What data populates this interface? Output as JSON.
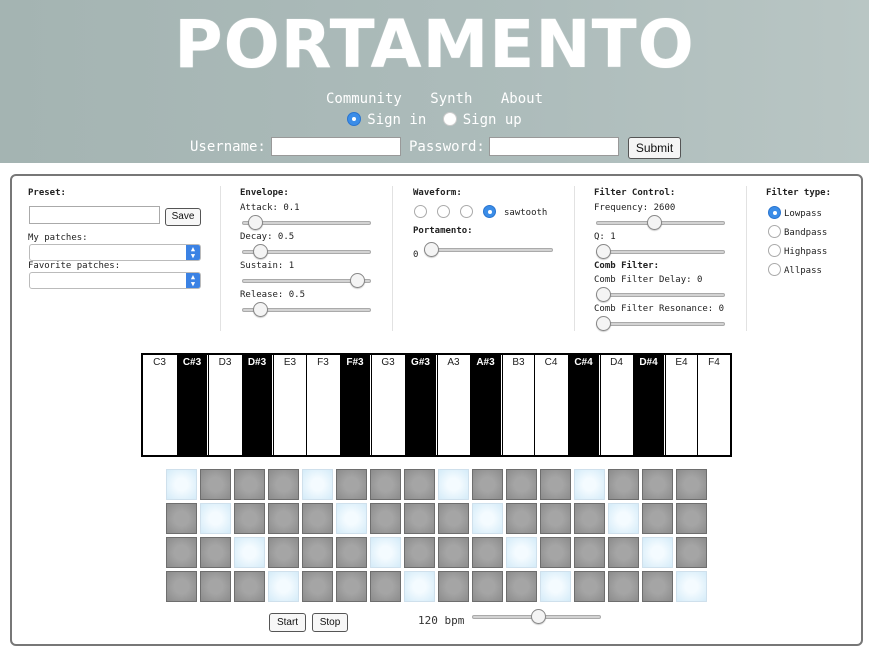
{
  "header": {
    "logo": "PORTAMENTO",
    "nav": [
      "Community",
      "Synth",
      "About"
    ],
    "auth_modes": [
      {
        "label": "Sign in",
        "checked": true
      },
      {
        "label": "Sign up",
        "checked": false
      }
    ],
    "username_label": "Username:",
    "password_label": "Password:",
    "submit_label": "Submit"
  },
  "preset": {
    "title": "Preset:",
    "save_label": "Save",
    "my_patches_label": "My patches:",
    "favorite_patches_label": "Favorite patches:"
  },
  "envelope": {
    "title": "Envelope:",
    "attack": {
      "label": "Attack: 0.1",
      "fraction": 0.05
    },
    "decay": {
      "label": "Decay: 0.5",
      "fraction": 0.1
    },
    "sustain": {
      "label": "Sustain: 1",
      "fraction": 0.95
    },
    "release": {
      "label": "Release: 0.5",
      "fraction": 0.1
    }
  },
  "waveform": {
    "title": "Waveform:",
    "selected_label": "sawtooth",
    "options_checked": [
      false,
      false,
      false,
      true
    ],
    "portamento_title": "Portamento:",
    "portamento_value": "0",
    "portamento_fraction": 0.0
  },
  "filter_control": {
    "title": "Filter Control:",
    "frequency": {
      "label": "Frequency: 2600",
      "fraction": 0.45
    },
    "q": {
      "label": "Q: 1",
      "fraction": 0.0
    },
    "comb_title": "Comb Filter:",
    "comb_delay": {
      "label": "Comb Filter Delay: 0",
      "fraction": 0.0
    },
    "comb_resonance": {
      "label": "Comb Filter Resonance: 0",
      "fraction": 0.0
    }
  },
  "filter_type": {
    "title": "Filter type:",
    "options": [
      {
        "label": "Lowpass",
        "checked": true
      },
      {
        "label": "Bandpass",
        "checked": false
      },
      {
        "label": "Highpass",
        "checked": false
      },
      {
        "label": "Allpass",
        "checked": false
      }
    ]
  },
  "keyboard": {
    "keys": [
      {
        "note": "C3",
        "color": "white"
      },
      {
        "note": "C#3",
        "color": "black"
      },
      {
        "note": "D3",
        "color": "white"
      },
      {
        "note": "D#3",
        "color": "black"
      },
      {
        "note": "E3",
        "color": "white"
      },
      {
        "note": "F3",
        "color": "white"
      },
      {
        "note": "F#3",
        "color": "black"
      },
      {
        "note": "G3",
        "color": "white"
      },
      {
        "note": "G#3",
        "color": "black"
      },
      {
        "note": "A3",
        "color": "white"
      },
      {
        "note": "A#3",
        "color": "black"
      },
      {
        "note": "B3",
        "color": "white"
      },
      {
        "note": "C4",
        "color": "white"
      },
      {
        "note": "C#4",
        "color": "black"
      },
      {
        "note": "D4",
        "color": "white"
      },
      {
        "note": "D#4",
        "color": "black"
      },
      {
        "note": "E4",
        "color": "white"
      },
      {
        "note": "F4",
        "color": "white"
      }
    ]
  },
  "sequencer": {
    "rows": [
      [
        1,
        0,
        0,
        0,
        1,
        0,
        0,
        0,
        1,
        0,
        0,
        0,
        1,
        0,
        0,
        0
      ],
      [
        0,
        1,
        0,
        0,
        0,
        1,
        0,
        0,
        0,
        1,
        0,
        0,
        0,
        1,
        0,
        0
      ],
      [
        0,
        0,
        1,
        0,
        0,
        0,
        1,
        0,
        0,
        0,
        1,
        0,
        0,
        0,
        1,
        0
      ],
      [
        0,
        0,
        0,
        1,
        0,
        0,
        0,
        1,
        0,
        0,
        0,
        1,
        0,
        0,
        0,
        1
      ]
    ],
    "start_label": "Start",
    "stop_label": "Stop",
    "bpm_label": "120 bpm",
    "bpm_fraction": 0.52
  },
  "colors": {
    "header_bg": "#adbcbb",
    "accent": "#3b8de8",
    "pad_on": "#e3f3fc",
    "pad_off": "#9a9a9a"
  }
}
